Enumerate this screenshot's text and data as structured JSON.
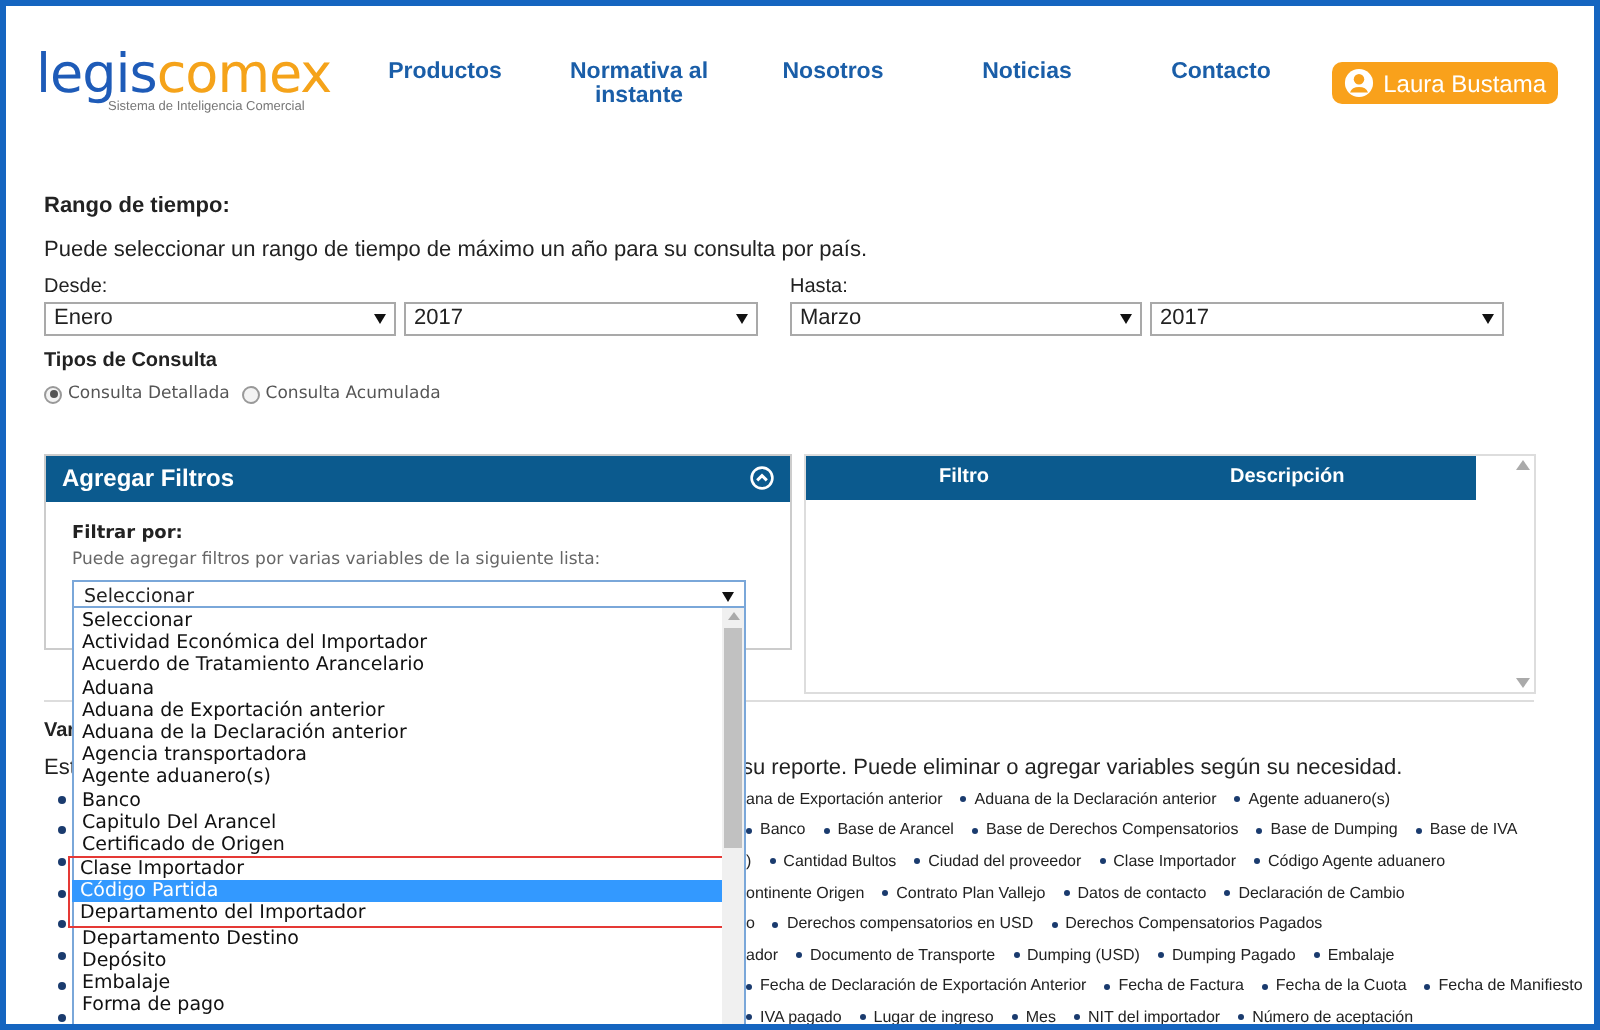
{
  "header": {
    "logo": {
      "part_1": "legis",
      "part_2": "comex",
      "tagline": "Sistema de Inteligencia Comercial"
    },
    "nav": [
      "Productos",
      "Normativa al instante",
      "Nosotros",
      "Noticias",
      "Contacto"
    ],
    "user": "Laura Bustama"
  },
  "time_range": {
    "title": "Rango de tiempo:",
    "description": "Puede seleccionar un rango de tiempo de máximo un año para su consulta por país.",
    "from": {
      "label": "Desde:",
      "month": "Enero",
      "year": "2017"
    },
    "to": {
      "label": "Hasta:",
      "month": "Marzo",
      "year": "2017"
    }
  },
  "query_types": {
    "title": "Tipos de Consulta",
    "options": [
      {
        "label": "Consulta Detallada",
        "selected": true
      },
      {
        "label": "Consulta Acumulada",
        "selected": false
      }
    ]
  },
  "filters": {
    "title": "Agregar Filtros",
    "expanded": true,
    "label": "Filtrar por:",
    "hint": "Puede agregar filtros por varias variables de la siguiente lista:",
    "select_value": "Seleccionar",
    "options": [
      {
        "label": "Seleccionar",
        "selected": false,
        "annotated": false
      },
      {
        "label": "Actividad Económica del Importador",
        "selected": false,
        "annotated": false
      },
      {
        "label": "Acuerdo de Tratamiento Arancelario",
        "selected": false,
        "annotated": false
      },
      {
        "label": "Aduana",
        "selected": false,
        "annotated": false
      },
      {
        "label": "Aduana de Exportación anterior",
        "selected": false,
        "annotated": false
      },
      {
        "label": "Aduana de la Declaración anterior",
        "selected": false,
        "annotated": false
      },
      {
        "label": "Agencia transportadora",
        "selected": false,
        "annotated": false
      },
      {
        "label": "Agente aduanero(s)",
        "selected": false,
        "annotated": false
      },
      {
        "label": "Banco",
        "selected": false,
        "annotated": false
      },
      {
        "label": "Capitulo Del Arancel",
        "selected": false,
        "annotated": false
      },
      {
        "label": "Certificado de Origen",
        "selected": false,
        "annotated": false
      },
      {
        "label": "Clase Importador",
        "selected": false,
        "annotated": true
      },
      {
        "label": "Código Partida",
        "selected": true,
        "annotated": true
      },
      {
        "label": "Departamento del Importador",
        "selected": false,
        "annotated": true
      },
      {
        "label": "Departamento Destino",
        "selected": false,
        "annotated": false
      },
      {
        "label": "Depósito",
        "selected": false,
        "annotated": false
      },
      {
        "label": "Embalaje",
        "selected": false,
        "annotated": false
      },
      {
        "label": "Forma de pago",
        "selected": false,
        "annotated": false
      }
    ]
  },
  "filter_table": {
    "columns": [
      "Filtro",
      "Descripción"
    ]
  },
  "variables": {
    "title": "Var",
    "description_start": "Est",
    "description_end": "su reporte. Puede eliminar o agregar variables según su necesidad.",
    "rows": [
      [
        {
          "kind": "fragment",
          "label": "ana de Exportación anterior"
        },
        {
          "kind": "item",
          "label": "Aduana de la Declaración anterior"
        },
        {
          "kind": "item",
          "label": "Agente aduanero(s)"
        }
      ],
      [
        {
          "kind": "item",
          "label": "Banco"
        },
        {
          "kind": "item",
          "label": "Base de Arancel"
        },
        {
          "kind": "item",
          "label": "Base de Derechos Compensatorios"
        },
        {
          "kind": "item",
          "label": "Base de Dumping"
        },
        {
          "kind": "item",
          "label": "Base de IVA"
        }
      ],
      [
        {
          "kind": "fragment",
          "label": ")"
        },
        {
          "kind": "item",
          "label": "Cantidad Bultos"
        },
        {
          "kind": "item",
          "label": "Ciudad del proveedor"
        },
        {
          "kind": "item",
          "label": "Clase Importador"
        },
        {
          "kind": "item",
          "label": "Código Agente aduanero"
        }
      ],
      [
        {
          "kind": "fragment",
          "label": "ontinente Origen"
        },
        {
          "kind": "item",
          "label": "Contrato Plan Vallejo"
        },
        {
          "kind": "item",
          "label": "Datos de contacto"
        },
        {
          "kind": "item",
          "label": "Declaración de Cambio"
        }
      ],
      [
        {
          "kind": "fragment",
          "label": "o"
        },
        {
          "kind": "item",
          "label": "Derechos compensatorios en USD"
        },
        {
          "kind": "item",
          "label": "Derechos Compensatorios Pagados"
        }
      ],
      [
        {
          "kind": "fragment",
          "label": "ador"
        },
        {
          "kind": "item",
          "label": "Documento de Transporte"
        },
        {
          "kind": "item",
          "label": "Dumping (USD)"
        },
        {
          "kind": "item",
          "label": "Dumping Pagado"
        },
        {
          "kind": "item",
          "label": "Embalaje"
        }
      ],
      [
        {
          "kind": "item",
          "label": "Fecha de Declaración de Exportación Anterior"
        },
        {
          "kind": "item",
          "label": "Fecha de Factura"
        },
        {
          "kind": "item",
          "label": "Fecha de la Cuota"
        },
        {
          "kind": "item",
          "label": "Fecha de Manifiesto"
        }
      ],
      [
        {
          "kind": "item",
          "label": "IVA pagado"
        },
        {
          "kind": "item",
          "label": "Lugar de ingreso"
        },
        {
          "kind": "item",
          "label": "Mes"
        },
        {
          "kind": "item",
          "label": "NIT del importador"
        },
        {
          "kind": "item",
          "label": "Número de aceptación"
        }
      ]
    ]
  }
}
